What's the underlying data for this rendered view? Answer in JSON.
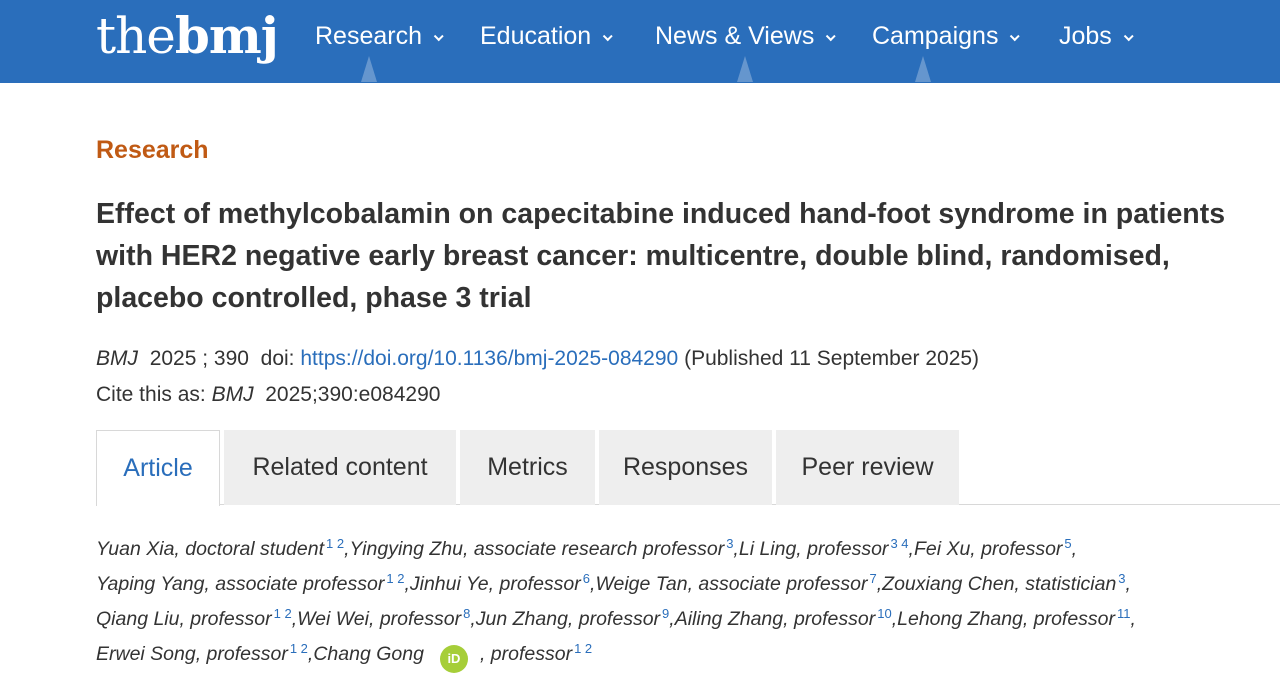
{
  "brand": {
    "logo_light": "the",
    "logo_bold": "bmj"
  },
  "nav": {
    "items": [
      {
        "label": "Research"
      },
      {
        "label": "Education"
      },
      {
        "label": "News & Views"
      },
      {
        "label": "Campaigns"
      },
      {
        "label": "Jobs"
      }
    ]
  },
  "article": {
    "section": "Research",
    "title": "Effect of methylcobalamin on capecitabine induced hand-foot syndrome in patients with HER2 negative early breast cancer: multicentre, double blind, randomised, placebo controlled, phase 3 trial",
    "journal": "BMJ",
    "volume_line": "2025 ; 390",
    "doi_label": "doi:",
    "doi_url": "https://doi.org/10.1136/bmj-2025-084290",
    "published": "(Published 11 September 2025)",
    "cite_label": "Cite this as:",
    "cite_journal": "BMJ",
    "cite_ref": "2025;390:e084290"
  },
  "tabs": [
    {
      "label": "Article",
      "active": true
    },
    {
      "label": "Related content",
      "active": false
    },
    {
      "label": "Metrics",
      "active": false
    },
    {
      "label": "Responses",
      "active": false
    },
    {
      "label": "Peer review",
      "active": false
    }
  ],
  "authors": [
    {
      "text": "Yuan Xia, doctoral student",
      "aff": "1 2"
    },
    {
      "text": "Yingying Zhu, associate research professor",
      "aff": "3"
    },
    {
      "text": "Li Ling, professor",
      "aff": "3 4"
    },
    {
      "text": "Fei Xu, professor",
      "aff": "5"
    },
    {
      "text": "Yaping Yang, associate professor",
      "aff": "1 2"
    },
    {
      "text": "Jinhui Ye, professor",
      "aff": "6"
    },
    {
      "text": "Weige Tan, associate professor",
      "aff": "7"
    },
    {
      "text": "Zouxiang Chen, statistician",
      "aff": "3"
    },
    {
      "text": "Qiang Liu, professor",
      "aff": "1 2"
    },
    {
      "text": "Wei Wei, professor",
      "aff": "8"
    },
    {
      "text": "Jun Zhang, professor",
      "aff": "9"
    },
    {
      "text": "Ailing Zhang, professor",
      "aff": "10"
    },
    {
      "text": "Lehong Zhang, professor",
      "aff": "11"
    },
    {
      "text": "Erwei Song, professor",
      "aff": "1 2"
    },
    {
      "name": "Chang Gong",
      "orcid_label": "iD",
      "role": ", professor",
      "aff": "1 2"
    }
  ],
  "colors": {
    "header_bg": "#2a6ebb",
    "section_kicker": "#c05a14",
    "link": "#2a6ebb",
    "tab_inactive_bg": "#eeeeee",
    "orcid": "#a6ce39"
  }
}
